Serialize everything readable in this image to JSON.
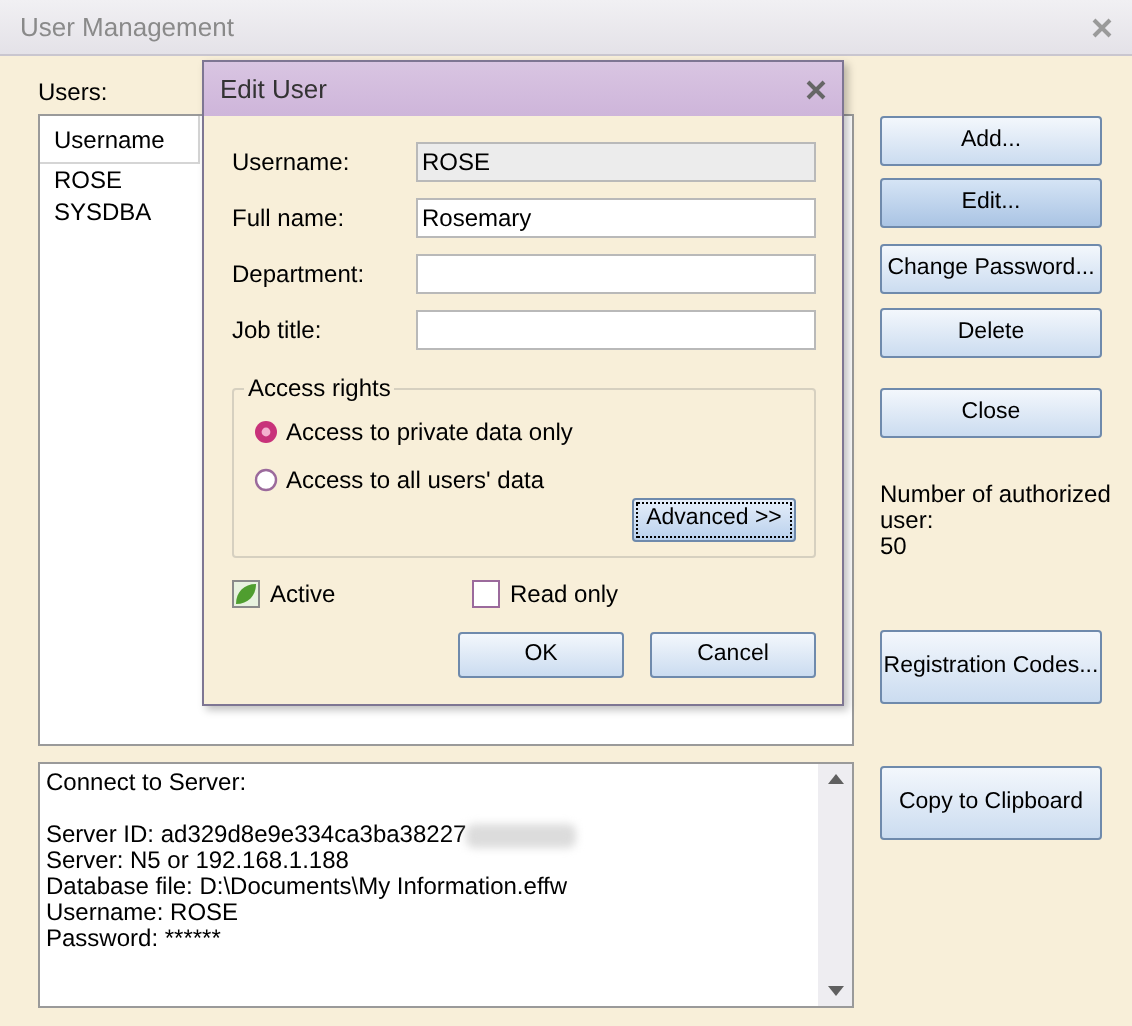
{
  "window": {
    "title": "User Management"
  },
  "users_label": "Users:",
  "users_list": {
    "column": "Username",
    "rows": [
      "ROSE",
      "SYSDBA"
    ]
  },
  "side_buttons": [
    {
      "label": "Add...",
      "focused": false
    },
    {
      "label": "Edit...",
      "focused": true
    },
    {
      "label": "Change Password...",
      "focused": false
    },
    {
      "label": "Delete",
      "focused": false
    },
    {
      "label": "Close",
      "focused": false
    }
  ],
  "authorized": [
    "Number of authorized user:",
    "50"
  ],
  "registration_button": "Registration Codes...",
  "info_header": "Connect to Server:",
  "info_lines": [
    "Server ID: ad329d8e9e334ca3ba38227",
    "Server: N5 or 192.168.1.188",
    "Database file: D:\\Documents\\My Information.effw",
    "Username: ROSE",
    "Password: ******"
  ],
  "copy_button": "Copy to Clipboard",
  "dialog": {
    "title": "Edit User",
    "fields": [
      {
        "label": "Username:",
        "value": "ROSE",
        "disabled": true
      },
      {
        "label": "Full name:",
        "value": "Rosemary",
        "disabled": false
      },
      {
        "label": "Department:",
        "disabled": false
      },
      {
        "label": "Job title:",
        "disabled": false
      }
    ],
    "access_rights": {
      "legend": "Access rights",
      "options": [
        {
          "label": "Access to private data only",
          "selected": true
        },
        {
          "label": "Access to all users' data",
          "selected": false
        }
      ],
      "advanced_button": "Advanced >>"
    },
    "checkboxes": [
      {
        "label": "Active",
        "checked": true
      },
      {
        "label": "Read only",
        "checked": false
      }
    ],
    "buttons": [
      "OK",
      "Cancel"
    ]
  }
}
